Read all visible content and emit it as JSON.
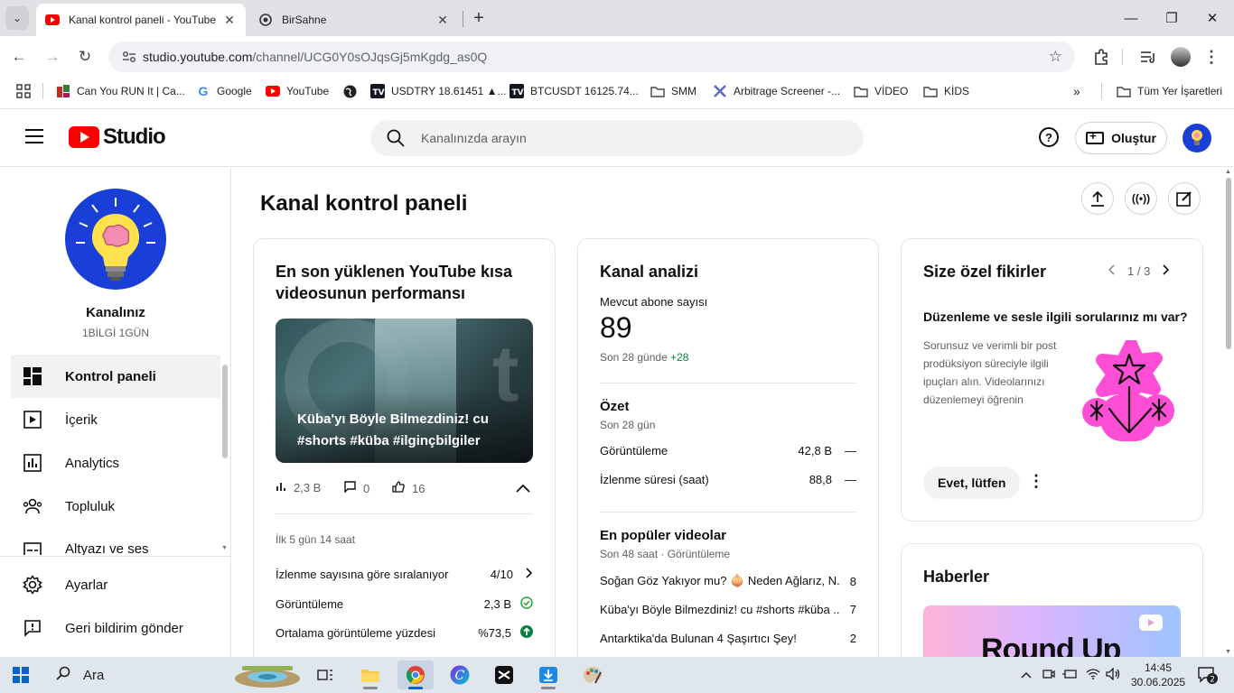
{
  "browser": {
    "tabs": [
      {
        "title": "Kanal kontrol paneli - YouTube",
        "active": true
      },
      {
        "title": "BirSahne",
        "active": false
      }
    ],
    "url_host": "studio.youtube.com",
    "url_path": "/channel/UCG0Y0sOJqsGj5mKgdg_as0Q",
    "bookmarks": [
      {
        "label": "Can You RUN It | Ca...",
        "icon": "canyourunit-icon"
      },
      {
        "label": "Google",
        "icon": "google-icon"
      },
      {
        "label": "YouTube",
        "icon": "youtube-icon"
      },
      {
        "label": "USDTRY 18.61451 ▲...",
        "icon": "tradingview-icon"
      },
      {
        "label": "BTCUSDT 16125.74...",
        "icon": "tradingview-icon"
      },
      {
        "label": "SMM",
        "icon": "folder-icon"
      },
      {
        "label": "Arbitrage Screener -...",
        "icon": "arbitrage-icon"
      },
      {
        "label": "VİDEO",
        "icon": "folder-icon"
      },
      {
        "label": "KİDS",
        "icon": "folder-icon"
      }
    ],
    "all_bookmarks": "Tüm Yer İşaretleri"
  },
  "studio": {
    "logo_text": "Studio",
    "search_placeholder": "Kanalınızda arayın",
    "create_label": "Oluştur"
  },
  "sidebar": {
    "channel_label": "Kanalınız",
    "channel_handle": "1BİLGİ 1GÜN",
    "items": [
      {
        "label": "Kontrol paneli",
        "icon": "dashboard-icon",
        "active": true
      },
      {
        "label": "İçerik",
        "icon": "content-icon"
      },
      {
        "label": "Analytics",
        "icon": "analytics-icon"
      },
      {
        "label": "Topluluk",
        "icon": "community-icon"
      },
      {
        "label": "Altyazı ve ses",
        "icon": "subtitles-icon"
      }
    ],
    "bottom_items": [
      {
        "label": "Ayarlar",
        "icon": "settings-icon"
      },
      {
        "label": "Geri bildirim gönder",
        "icon": "feedback-icon"
      }
    ]
  },
  "main": {
    "page_title": "Kanal kontrol paneli",
    "latest_short": {
      "title": "En son yüklenen YouTube kısa videosunun performansı",
      "thumbnail_caption": "Küba'yı Böyle Bilmezdiniz! cu #shorts #küba #ilginçbilgiler",
      "views": "2,3 B",
      "comments": "0",
      "likes": "16",
      "period": "İlk 5 gün 14 saat",
      "rows": [
        {
          "label": "İzlenme sayısına göre sıralanıyor",
          "value": "4/10",
          "status": "chevron-right-icon"
        },
        {
          "label": "Görüntüleme",
          "value": "2,3 B",
          "status": "check-circle-icon"
        },
        {
          "label": "Ortalama görüntüleme yüzdesi",
          "value": "%73,5",
          "status": "arrow-up-circle-icon"
        }
      ]
    },
    "analytics": {
      "title": "Kanal analizi",
      "subs_label": "Mevcut abone sayısı",
      "subs_count": "89",
      "subs_change_label": "Son 28 günde",
      "subs_change": "+28",
      "summary_title": "Özet",
      "summary_period": "Son 28 gün",
      "summary_rows": [
        {
          "label": "Görüntüleme",
          "value": "42,8 B",
          "trend": "—"
        },
        {
          "label": "İzlenme süresi (saat)",
          "value": "88,8",
          "trend": "—"
        }
      ],
      "top_title": "En popüler videolar",
      "top_period": "Son 48 saat · Görüntüleme",
      "top_videos": [
        {
          "title": "Soğan Göz Yakıyor mu? 🧅 Neden Ağlarız, N...",
          "value": "8"
        },
        {
          "title": "Küba'yı Böyle Bilmezdiniz! cu #shorts #küba ...",
          "value": "7"
        },
        {
          "title": "Antarktika'da Bulunan 4 Şaşırtıcı Şey!",
          "value": "2"
        }
      ]
    },
    "ideas": {
      "title": "Size özel fikirler",
      "pager": "1 / 3",
      "heading": "Düzenleme ve sesle ilgili sorularınız mı var?",
      "body": "Sorunsuz ve verimli bir post prodüksiyon süreciyle ilgili ipuçları alın. Videolarınızı düzenlemeyi öğrenin",
      "cta": "Evet, lütfen"
    },
    "news": {
      "title": "Haberler",
      "banner_text": "Round Up"
    }
  },
  "taskbar": {
    "search_label": "Ara",
    "time": "14:45",
    "date": "30.06.2025",
    "notifications": "2"
  }
}
